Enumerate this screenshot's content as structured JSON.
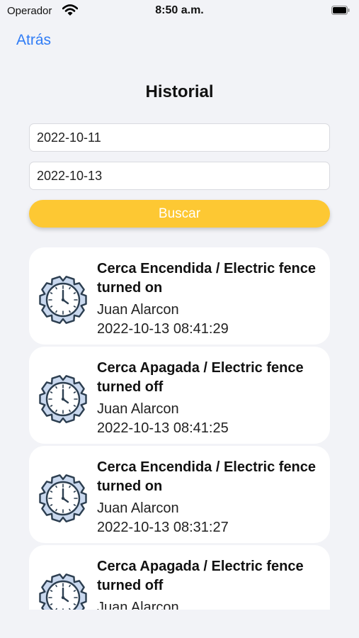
{
  "status": {
    "carrier": "Operador",
    "time": "8:50 a.m."
  },
  "nav": {
    "back_label": "Atrás"
  },
  "page": {
    "title": "Historial"
  },
  "filters": {
    "from_date": "2022-10-11",
    "to_date": "2022-10-13",
    "search_label": "Buscar"
  },
  "colors": {
    "accent_blue": "#2f7cf6",
    "button_yellow": "#fdc833",
    "icon_fill": "#c9d8ee",
    "icon_stroke": "#2c3e50"
  },
  "history": [
    {
      "event": "Cerca Encendida / Electric fence turned on",
      "user": "Juan Alarcon",
      "datetime": "2022-10-13 08:41:29",
      "icon": "clock-gear-icon"
    },
    {
      "event": "Cerca Apagada / Electric fence turned off",
      "user": "Juan Alarcon",
      "datetime": "2022-10-13 08:41:25",
      "icon": "clock-gear-icon"
    },
    {
      "event": "Cerca Encendida / Electric fence turned on",
      "user": "Juan Alarcon",
      "datetime": "2022-10-13 08:31:27",
      "icon": "clock-gear-icon"
    },
    {
      "event": "Cerca Apagada / Electric fence turned off",
      "user": "Juan Alarcon",
      "datetime": "",
      "icon": "clock-gear-icon"
    }
  ]
}
